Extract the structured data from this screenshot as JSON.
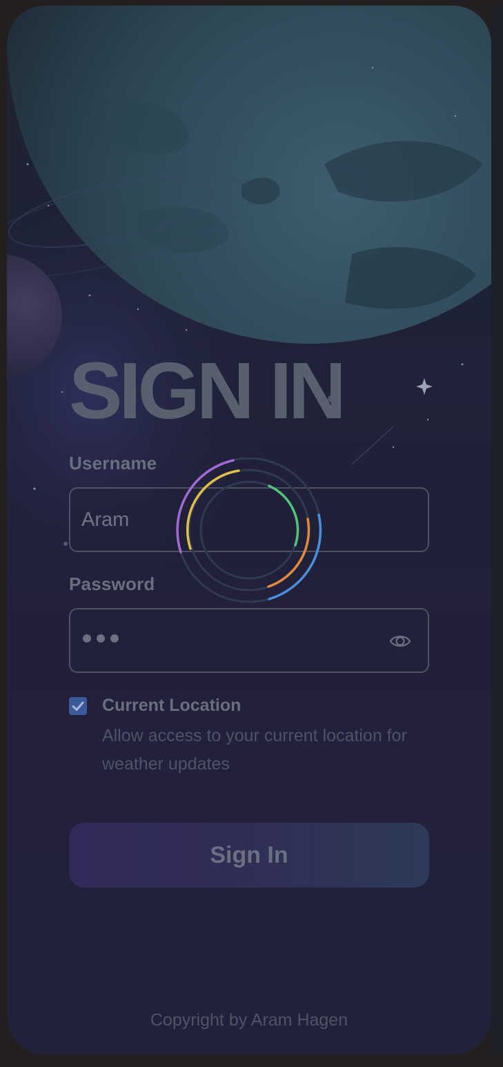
{
  "heading": "SIGN IN",
  "username": {
    "label": "Username",
    "value": "Aram"
  },
  "password": {
    "label": "Password",
    "masked_length": 3,
    "toggle_icon": "eye-icon"
  },
  "location": {
    "checked": true,
    "title": "Current Location",
    "description": "Allow access to your current location for weather updates"
  },
  "submit_label": "Sign In",
  "footer": "Copyright by Aram Hagen",
  "loader": {
    "icon": "loading-spinner-icon",
    "ring_colors": [
      "#a26ad6",
      "#e2c04a",
      "#52c47a",
      "#e08a3c",
      "#4a8fdc"
    ]
  },
  "colors": {
    "background": "#221f3a",
    "accent": "#3a5a99"
  }
}
